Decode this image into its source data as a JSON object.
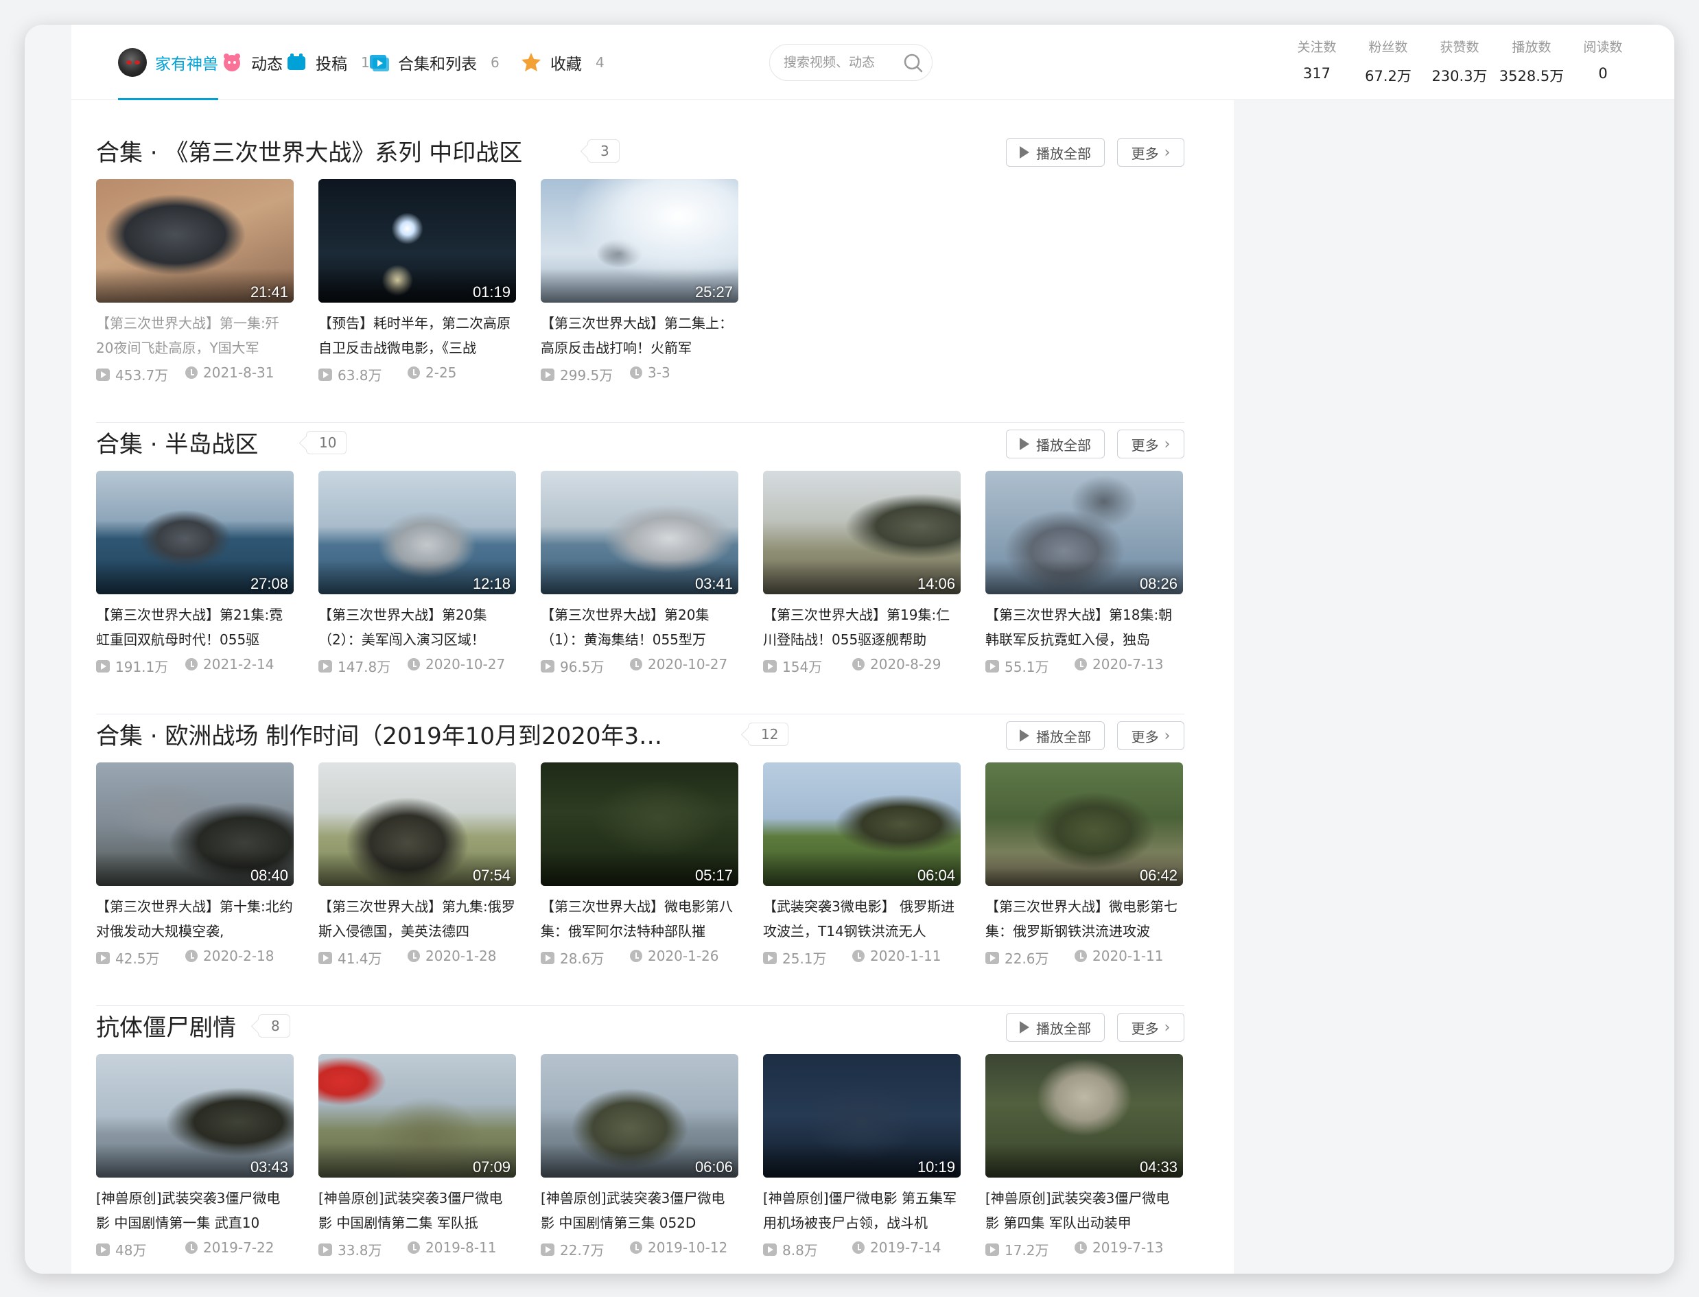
{
  "nav": {
    "tabs": [
      {
        "label": "家有神兽",
        "icon": "user-avatar-icon",
        "count": ""
      },
      {
        "label": "动态",
        "icon": "dynamic-icon",
        "count": ""
      },
      {
        "label": "投稿",
        "icon": "upload-icon",
        "count": "157"
      },
      {
        "label": "合集和列表",
        "icon": "collection-icon",
        "count": "6"
      },
      {
        "label": "收藏",
        "icon": "star-icon",
        "count": "4"
      }
    ],
    "search_placeholder": "搜索视频、动态",
    "stats": [
      {
        "label": "关注数",
        "value": "317"
      },
      {
        "label": "粉丝数",
        "value": "67.2万"
      },
      {
        "label": "获赞数",
        "value": "230.3万"
      },
      {
        "label": "播放数",
        "value": "3528.5万"
      },
      {
        "label": "阅读数",
        "value": "0"
      }
    ]
  },
  "buttons": {
    "play_all": "播放全部",
    "more": "更多"
  },
  "colors": {
    "accent": "#00a1d6"
  },
  "sections": [
    {
      "title": "合集 · 《第三次世界大战》系列 中印战区",
      "count": "3",
      "videos": [
        {
          "title": "【第三次世界大战】第一集:歼20夜间飞赴高原，Y国大军",
          "duration": "21:41",
          "plays": "453.7万",
          "date": "2021-8-31",
          "visited": true
        },
        {
          "title": "【预告】耗时半年，第二次高原自卫反击战微电影，《三战",
          "duration": "01:19",
          "plays": "63.8万",
          "date": "2-25",
          "visited": false
        },
        {
          "title": "【第三次世界大战】第二集上：高原反击战打响！火箭军",
          "duration": "25:27",
          "plays": "299.5万",
          "date": "3-3",
          "visited": false
        }
      ]
    },
    {
      "title": "合集 · 半岛战区",
      "count": "10",
      "videos": [
        {
          "title": "【第三次世界大战】第21集:霓虹重回双航母时代！055驱",
          "duration": "27:08",
          "plays": "191.1万",
          "date": "2021-2-14",
          "visited": false
        },
        {
          "title": "【第三次世界大战】第20集（2）：美军闯入演习区域！",
          "duration": "12:18",
          "plays": "147.8万",
          "date": "2020-10-27",
          "visited": false
        },
        {
          "title": "【第三次世界大战】第20集（1）：黄海集结！055型万",
          "duration": "03:41",
          "plays": "96.5万",
          "date": "2020-10-27",
          "visited": false
        },
        {
          "title": "【第三次世界大战】第19集:仁川登陆战！055驱逐舰帮助",
          "duration": "14:06",
          "plays": "154万",
          "date": "2020-8-29",
          "visited": false
        },
        {
          "title": "【第三次世界大战】第18集:朝韩联军反抗霓虹入侵，独岛",
          "duration": "08:26",
          "plays": "55.1万",
          "date": "2020-7-13",
          "visited": false
        }
      ]
    },
    {
      "title": "合集 · 欧洲战场 制作时间（2019年10月到2020年3…",
      "count": "12",
      "videos": [
        {
          "title": "【第三次世界大战】第十集:北约对俄发动大规模空袭,",
          "duration": "08:40",
          "plays": "42.5万",
          "date": "2020-2-18",
          "visited": false
        },
        {
          "title": "【第三次世界大战】第九集:俄罗斯入侵德国，美英法德四",
          "duration": "07:54",
          "plays": "41.4万",
          "date": "2020-1-28",
          "visited": false
        },
        {
          "title": "【第三次世界大战】微电影第八集：俄军阿尔法特种部队摧",
          "duration": "05:17",
          "plays": "28.6万",
          "date": "2020-1-26",
          "visited": false
        },
        {
          "title": "【武装突袭3微电影】 俄罗斯进攻波兰，T14钢铁洪流无人",
          "duration": "06:04",
          "plays": "25.1万",
          "date": "2020-1-11",
          "visited": false
        },
        {
          "title": "【第三次世界大战】微电影第七集：俄罗斯钢铁洪流进攻波",
          "duration": "06:42",
          "plays": "22.6万",
          "date": "2020-1-11",
          "visited": false
        }
      ]
    },
    {
      "title": "抗体僵尸剧情",
      "count": "8",
      "videos": [
        {
          "title": "[神兽原创]武装突袭3僵尸微电影 中国剧情第一集 武直10",
          "duration": "03:43",
          "plays": "48万",
          "date": "2019-7-22",
          "visited": false
        },
        {
          "title": "[神兽原创]武装突袭3僵尸微电影 中国剧情第二集 军队抵",
          "duration": "07:09",
          "plays": "33.8万",
          "date": "2019-8-11",
          "visited": false
        },
        {
          "title": "[神兽原创]武装突袭3僵尸微电影 中国剧情第三集 052D",
          "duration": "06:06",
          "plays": "22.7万",
          "date": "2019-10-12",
          "visited": false
        },
        {
          "title": "[神兽原创]僵尸微电影 第五集军用机场被丧尸占领，战斗机",
          "duration": "10:19",
          "plays": "8.8万",
          "date": "2019-7-14",
          "visited": false
        },
        {
          "title": "[神兽原创]武装突袭3僵尸微电影 第四集 军队出动装甲",
          "duration": "04:33",
          "plays": "17.2万",
          "date": "2019-7-13",
          "visited": false
        }
      ]
    }
  ]
}
